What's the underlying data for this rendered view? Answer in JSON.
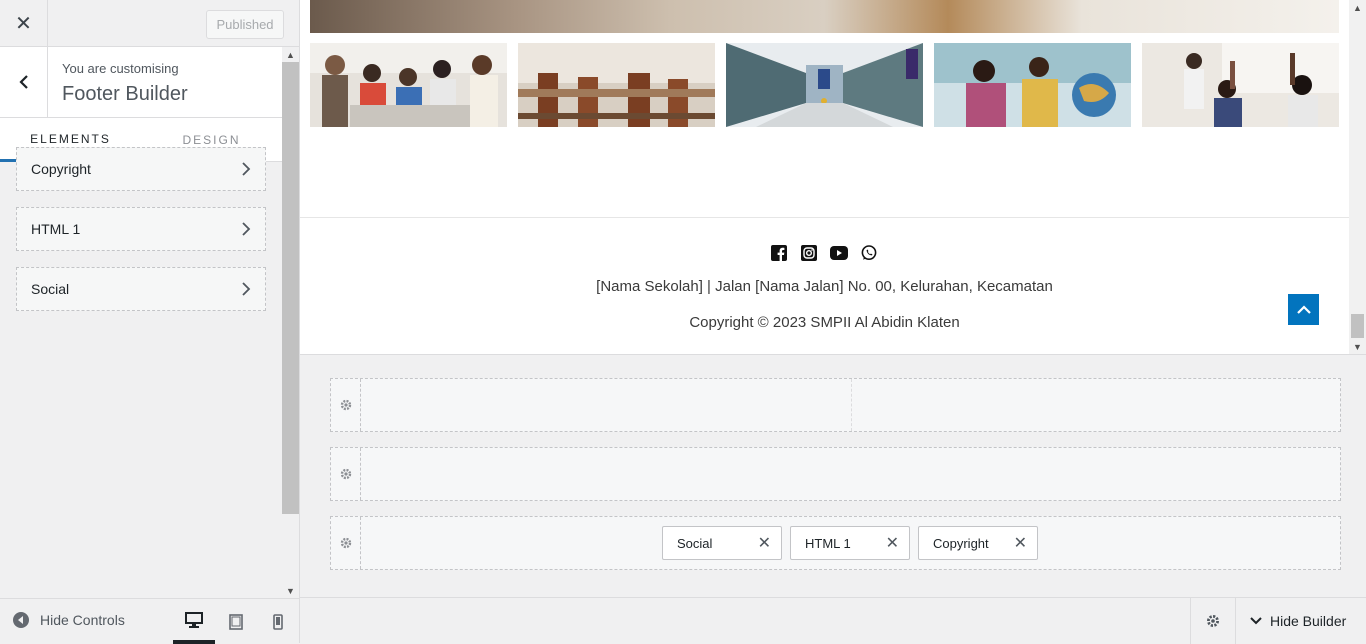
{
  "header": {
    "close_icon": "close-icon",
    "published_label": "Published"
  },
  "panel": {
    "customising_label": "You are customising",
    "title": "Footer Builder",
    "tabs": [
      {
        "label": "Elements",
        "active": true
      },
      {
        "label": "Design",
        "active": false
      }
    ],
    "elements": [
      {
        "label": "Copyright"
      },
      {
        "label": "HTML 1"
      },
      {
        "label": "Social"
      }
    ],
    "footer": {
      "hide_controls_label": "Hide Controls",
      "devices": [
        "desktop-icon",
        "tablet-icon",
        "mobile-icon"
      ]
    }
  },
  "preview": {
    "gallery_alt": [
      "students-celebrating",
      "empty-classroom",
      "school-hallway",
      "students-with-globe",
      "students-raising-hands"
    ],
    "social_icons": [
      "facebook-icon",
      "instagram-icon",
      "youtube-icon",
      "whatsapp-icon"
    ],
    "address": "[Nama Sekolah] | Jalan [Nama Jalan] No. 00, Kelurahan, Kecamatan",
    "copyright": "Copyright © 2023 SMPII Al Abidin Klaten",
    "accent_color": "#0274be"
  },
  "builder": {
    "chips": [
      {
        "label": "Social"
      },
      {
        "label": "HTML 1"
      },
      {
        "label": "Copyright"
      }
    ],
    "hide_builder_label": "Hide Builder"
  }
}
